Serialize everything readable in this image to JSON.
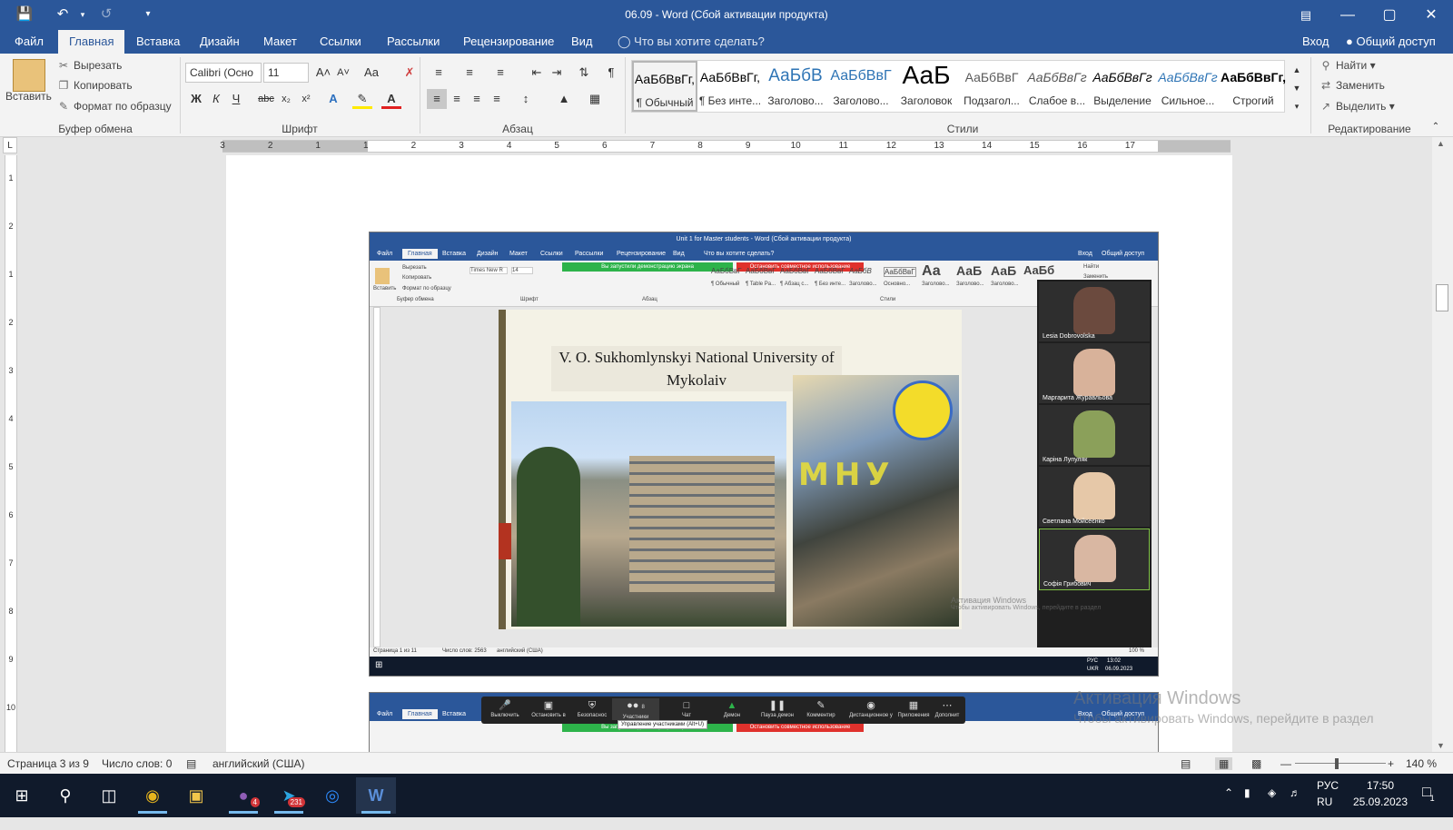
{
  "window": {
    "title": "06.09 - Word (Сбой активации продукта)",
    "sign_in": "Вход",
    "share": "Общий доступ"
  },
  "tabs": [
    "Файл",
    "Главная",
    "Вставка",
    "Дизайн",
    "Макет",
    "Ссылки",
    "Рассылки",
    "Рецензирование",
    "Вид"
  ],
  "tell_me": "Что вы хотите сделать?",
  "clipboard": {
    "paste": "Вставить",
    "cut": "Вырезать",
    "copy": "Копировать",
    "format_painter": "Формат по образцу",
    "label": "Буфер обмена"
  },
  "font": {
    "name": "Calibri (Осно",
    "size": "11",
    "label": "Шрифт"
  },
  "paragraph": {
    "label": "Абзац"
  },
  "styles": {
    "label": "Стили",
    "items": [
      {
        "sample": "АаБбВвГг,",
        "name": "¶ Обычный"
      },
      {
        "sample": "АаБбВвГг,",
        "name": "¶ Без инте..."
      },
      {
        "sample": "АаБбВ",
        "name": "Заголово..."
      },
      {
        "sample": "АаБбВвГ",
        "name": "Заголово..."
      },
      {
        "sample": "АаБ",
        "name": "Заголовок"
      },
      {
        "sample": "АаБбВвГ",
        "name": "Подзагол..."
      },
      {
        "sample": "АаБбВвГг",
        "name": "Слабое в..."
      },
      {
        "sample": "АаБбВвГг",
        "name": "Выделение"
      },
      {
        "sample": "АаБбВвГг",
        "name": "Сильное..."
      },
      {
        "sample": "АаБбВвГг,",
        "name": "Строгий"
      }
    ]
  },
  "editing": {
    "find": "Найти",
    "replace": "Заменить",
    "select": "Выделить",
    "label": "Редактирование"
  },
  "ruler": {
    "numbers": [
      "3",
      "2",
      "1",
      "1",
      "2",
      "3",
      "4",
      "5",
      "6",
      "7",
      "8",
      "9",
      "10",
      "11",
      "12",
      "13",
      "14",
      "15",
      "16",
      "17"
    ],
    "vnumbers": [
      "1",
      "2",
      "1",
      "2",
      "3",
      "4",
      "5",
      "6",
      "7",
      "8",
      "9",
      "10"
    ]
  },
  "embedded": {
    "title": "Unit 1 for Master students - Word (Сбой активации продукта)",
    "sign_in": "Вход",
    "share": "Общий доступ",
    "tabs": [
      "Файл",
      "Главная",
      "Вставка",
      "Дизайн",
      "Макет",
      "Ссылки",
      "Рассылки",
      "Рецензирование",
      "Вид"
    ],
    "tell_me": "Что вы хотите сделать?",
    "demo_banner": "Вы запустили демонстрацию экрана",
    "stop_banner": "Остановить совместное использование",
    "clip_items": [
      "Вырезать",
      "Копировать",
      "Формат по образцу"
    ],
    "paste": "Вставить",
    "group_labels": [
      "Буфер обмена",
      "Шрифт",
      "Абзац",
      "Стили"
    ],
    "font_name": "Times New R",
    "font_size": "14",
    "style_samples": [
      "АаБбВвГ",
      "АаБбВвГ",
      "АаБбВвГ",
      "АаБбВвГ",
      "АаБбВ",
      "АаБбВвГ",
      "Аа",
      "АаБ",
      "АаБ",
      "АаБб"
    ],
    "style_names": [
      "¶ Обычный",
      "¶ Table Pa...",
      "¶ Абзац с...",
      "¶ Без инте...",
      "Заголово...",
      "Основно...",
      "Заголово...",
      "Заголово...",
      "Заголово..."
    ],
    "find": "Найти",
    "replace": "Заменить",
    "slide_title": "V. O. Sukhomlynskyi National University of Mykolaiv",
    "participants": [
      "Lesia Dobrovolska",
      "Маргарита Журавльова",
      "Каріна Лупуляк",
      "Светлана Мойсеєнко",
      "Софія Грибович"
    ],
    "status_page": "Страница 1 из 11",
    "status_words": "Число слов: 2563",
    "status_lang": "английский (США)",
    "zoom": "100 %",
    "watermark_title": "Активация Windows",
    "watermark_sub": "Чтобы активировать Windows, перейдите в раздел",
    "tray_lang1": "РУС",
    "tray_lang2": "UKR",
    "tray_time": "13:02",
    "tray_date": "06.09.2023"
  },
  "zoom_toolbar": {
    "items": [
      "Выключить",
      "Остановить в",
      "Безопаснос",
      "Участники",
      "Чат",
      "Демон",
      "Пауза демон",
      "Комментир",
      "Дистанционное у",
      "Приложения",
      "Дополнит"
    ],
    "participants_count": "8",
    "tooltip": "Управление участниками (Alt+U)"
  },
  "watermark": {
    "title": "Активация Windows",
    "subtitle": "Чтобы активировать Windows, перейдите в раздел"
  },
  "status": {
    "page": "Страница 3 из 9",
    "words": "Число слов: 0",
    "language": "английский (США)",
    "zoom": "140 %"
  },
  "taskbar": {
    "viber_badge": "4",
    "telegram_badge": "231",
    "lang1": "РУС",
    "lang2": "RU",
    "time": "17:50",
    "date": "25.09.2023",
    "notif": "1"
  },
  "colors": {
    "word_blue": "#2b579a",
    "taskbar": "#101a2b",
    "zoom_green": "#2db34a",
    "zoom_red": "#e0312c"
  }
}
